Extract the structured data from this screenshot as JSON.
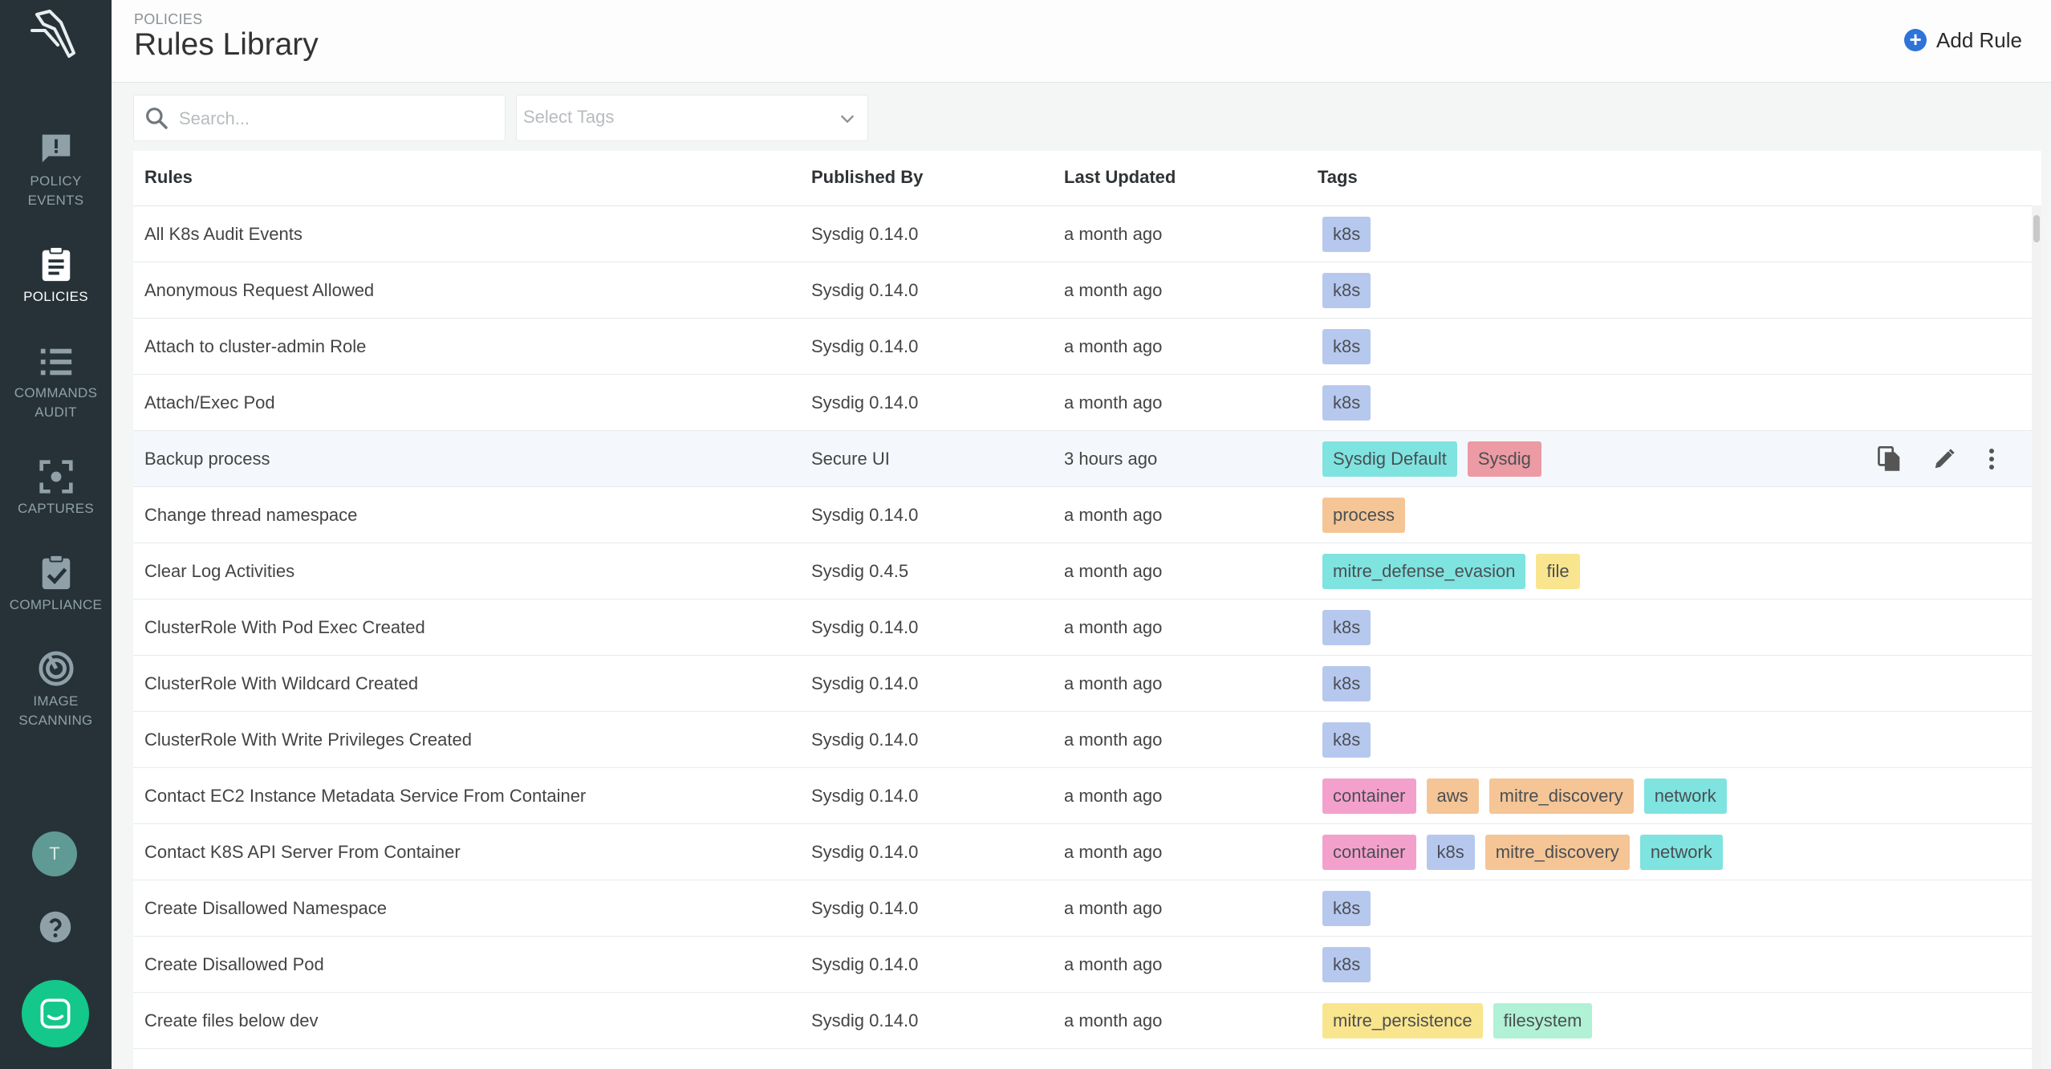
{
  "sidebar": {
    "items": [
      {
        "label_1": "POLICY",
        "label_2": "EVENTS",
        "icon": "policy-events-icon"
      },
      {
        "label_1": "POLICIES",
        "label_2": "",
        "icon": "policies-icon",
        "active": true
      },
      {
        "label_1": "COMMANDS",
        "label_2": "AUDIT",
        "icon": "commands-audit-icon"
      },
      {
        "label_1": "CAPTURES",
        "label_2": "",
        "icon": "captures-icon"
      },
      {
        "label_1": "COMPLIANCE",
        "label_2": "",
        "icon": "compliance-icon"
      },
      {
        "label_1": "IMAGE",
        "label_2": "SCANNING",
        "icon": "image-scanning-icon"
      }
    ],
    "avatar_initial": "T"
  },
  "header": {
    "breadcrumb": "POLICIES",
    "title": "Rules Library",
    "add_rule_label": "Add Rule"
  },
  "filters": {
    "search_placeholder": "Search...",
    "tags_placeholder": "Select Tags"
  },
  "table": {
    "columns": [
      "Rules",
      "Published By",
      "Last Updated",
      "Tags"
    ],
    "rows": [
      {
        "rule": "All K8s Audit Events",
        "published_by": "Sysdig 0.14.0",
        "updated": "a month ago",
        "tags": [
          "k8s"
        ]
      },
      {
        "rule": "Anonymous Request Allowed",
        "published_by": "Sysdig 0.14.0",
        "updated": "a month ago",
        "tags": [
          "k8s"
        ]
      },
      {
        "rule": "Attach to cluster-admin Role",
        "published_by": "Sysdig 0.14.0",
        "updated": "a month ago",
        "tags": [
          "k8s"
        ]
      },
      {
        "rule": "Attach/Exec Pod",
        "published_by": "Sysdig 0.14.0",
        "updated": "a month ago",
        "tags": [
          "k8s"
        ]
      },
      {
        "rule": "Backup process",
        "published_by": "Secure UI",
        "updated": "3 hours ago",
        "tags": [
          "Sysdig Default",
          "Sysdig"
        ],
        "hover": true
      },
      {
        "rule": "Change thread namespace",
        "published_by": "Sysdig 0.14.0",
        "updated": "a month ago",
        "tags": [
          "process"
        ]
      },
      {
        "rule": "Clear Log Activities",
        "published_by": "Sysdig 0.4.5",
        "updated": "a month ago",
        "tags": [
          "mitre_defense_evasion",
          "file"
        ]
      },
      {
        "rule": "ClusterRole With Pod Exec Created",
        "published_by": "Sysdig 0.14.0",
        "updated": "a month ago",
        "tags": [
          "k8s"
        ]
      },
      {
        "rule": "ClusterRole With Wildcard Created",
        "published_by": "Sysdig 0.14.0",
        "updated": "a month ago",
        "tags": [
          "k8s"
        ]
      },
      {
        "rule": "ClusterRole With Write Privileges Created",
        "published_by": "Sysdig 0.14.0",
        "updated": "a month ago",
        "tags": [
          "k8s"
        ]
      },
      {
        "rule": "Contact EC2 Instance Metadata Service From Container",
        "published_by": "Sysdig 0.14.0",
        "updated": "a month ago",
        "tags": [
          "container",
          "aws",
          "mitre_discovery",
          "network"
        ]
      },
      {
        "rule": "Contact K8S API Server From Container",
        "published_by": "Sysdig 0.14.0",
        "updated": "a month ago",
        "tags": [
          "container",
          "k8s",
          "mitre_discovery",
          "network"
        ]
      },
      {
        "rule": "Create Disallowed Namespace",
        "published_by": "Sysdig 0.14.0",
        "updated": "a month ago",
        "tags": [
          "k8s"
        ]
      },
      {
        "rule": "Create Disallowed Pod",
        "published_by": "Sysdig 0.14.0",
        "updated": "a month ago",
        "tags": [
          "k8s"
        ]
      },
      {
        "rule": "Create files below dev",
        "published_by": "Sysdig 0.14.0",
        "updated": "a month ago",
        "tags": [
          "mitre_persistence",
          "filesystem"
        ]
      }
    ],
    "row_actions": [
      "copy-icon",
      "edit-icon",
      "more-vertical-icon"
    ]
  },
  "tag_colors": {
    "k8s": "#b7c8ef",
    "Sysdig Default": "#7fe3e0",
    "Sysdig": "#ec9aa3",
    "process": "#f5c596",
    "mitre_defense_evasion": "#7fe3e0",
    "file": "#f9e58e",
    "container": "#f4a0cd",
    "aws": "#f5c596",
    "mitre_discovery": "#f5c596",
    "network": "#7fe3e0",
    "mitre_persistence": "#f9e58e",
    "filesystem": "#b1f1d5"
  },
  "colors": {
    "sidebar_bg": "#263238",
    "accent": "#2d73d8",
    "chat": "#14c78a"
  }
}
